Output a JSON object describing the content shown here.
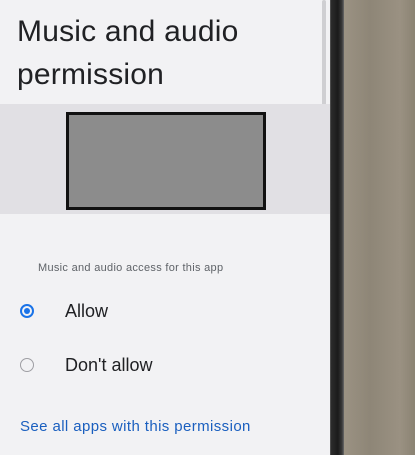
{
  "page": {
    "title_line1": "Music and audio",
    "title_line2": "permission"
  },
  "access": {
    "section_label": "Music and audio access for this app",
    "options": [
      {
        "label": "Allow",
        "selected": true
      },
      {
        "label": "Don't allow",
        "selected": false
      }
    ]
  },
  "footer": {
    "link_label": "See all apps with this permission"
  },
  "colors": {
    "accent": "#1a73e8",
    "link": "#1a5fbf",
    "screen_bg": "#f2f2f4",
    "redaction": "#8c8c8c"
  }
}
